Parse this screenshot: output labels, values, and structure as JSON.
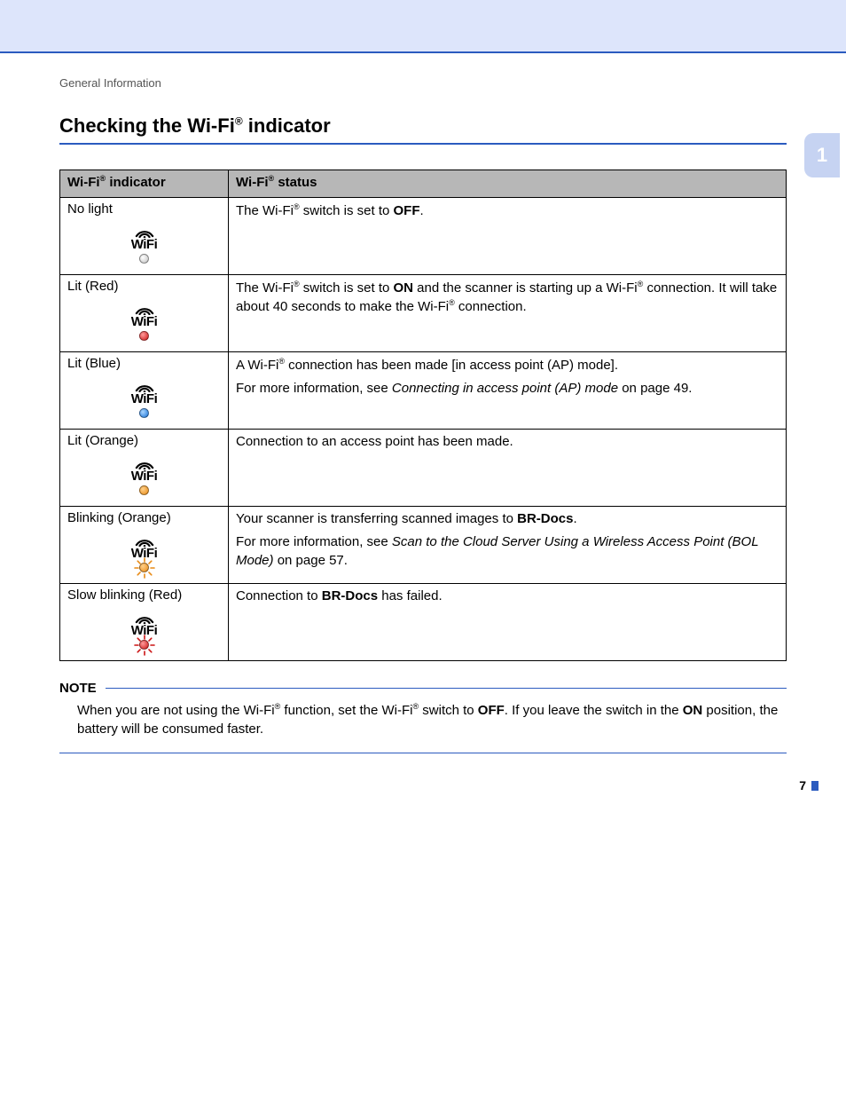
{
  "breadcrumb": "General Information",
  "heading_pre": "Checking the Wi-Fi",
  "heading_post": " indicator",
  "reg": "®",
  "side_tab": "1",
  "page_number": "7",
  "table": {
    "header_indicator_pre": "Wi-Fi",
    "header_indicator_post": " indicator",
    "header_status_pre": "Wi-Fi",
    "header_status_post": " status",
    "rows": [
      {
        "label": "No light",
        "led_class": "led-off",
        "blinking": false,
        "ray_color": "",
        "status_html": "The Wi-Fi<sup>®</sup> switch is set to <b>OFF</b>."
      },
      {
        "label": "Lit (Red)",
        "led_class": "led-red",
        "blinking": false,
        "ray_color": "",
        "status_html": "The Wi-Fi<sup>®</sup> switch is set to <b>ON</b> and the scanner is starting up a Wi-Fi<sup>®</sup> connection. It will take about 40 seconds to make the Wi-Fi<sup>®</sup> connection."
      },
      {
        "label": "Lit (Blue)",
        "led_class": "led-blue",
        "blinking": false,
        "ray_color": "",
        "status_html": "A Wi-Fi<sup>®</sup> connection has been made [in access point (AP) mode].<p>For more information, see <i>Connecting in access point (AP) mode</i> on page 49.</p>"
      },
      {
        "label": "Lit (Orange)",
        "led_class": "led-orange",
        "blinking": false,
        "ray_color": "",
        "status_html": "Connection to an access point has been made."
      },
      {
        "label": "Blinking (Orange)",
        "led_class": "led-orange",
        "blinking": true,
        "ray_color": "#e88a14",
        "status_html": "Your scanner is transferring scanned images to <b>BR-Docs</b>.<p>For more information, see <i>Scan to the Cloud Server Using a Wireless Access Point (BOL Mode)</i> on page 57.</p>"
      },
      {
        "label": "Slow blinking (Red)",
        "led_class": "led-red",
        "blinking": true,
        "ray_color": "#cc1414",
        "status_html": "Connection to <b>BR-Docs</b> has failed."
      }
    ]
  },
  "note": {
    "title": "NOTE",
    "body_html": "When you are not using the Wi-Fi<sup>®</sup> function, set the Wi-Fi<sup>®</sup> switch to <b>OFF</b>. If you leave the switch in the <b>ON</b> position, the battery will be consumed faster."
  }
}
